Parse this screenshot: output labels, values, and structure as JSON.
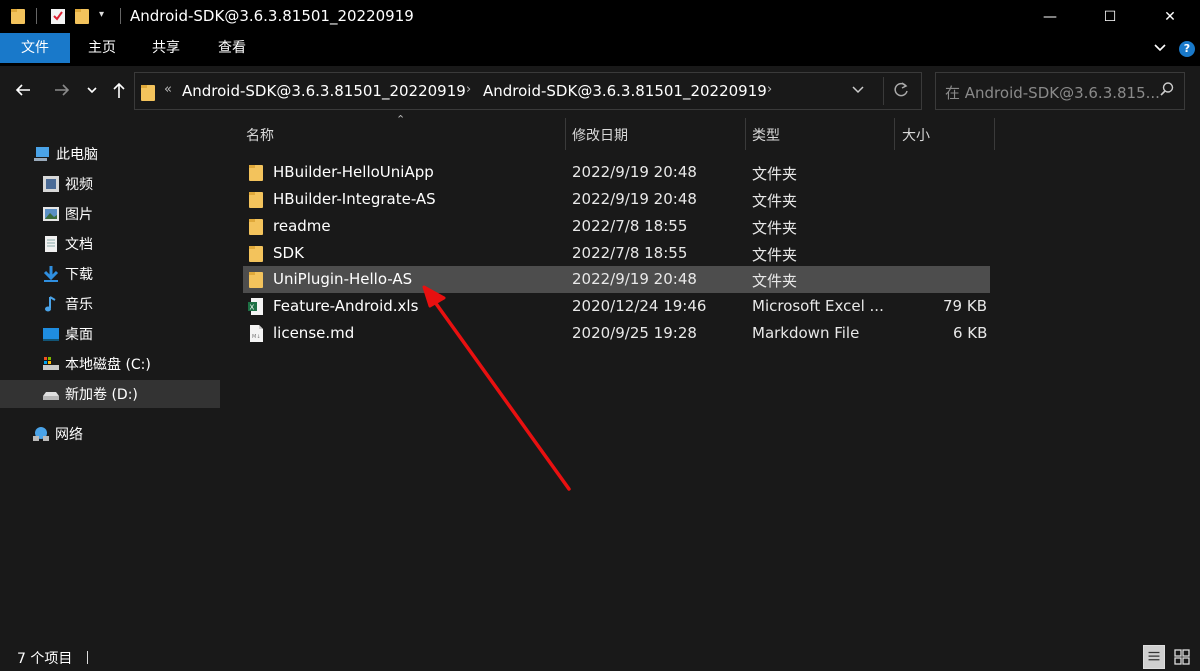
{
  "window": {
    "title": "Android-SDK@3.6.3.81501_20220919",
    "minimize_glyph": "—",
    "maximize_glyph": "☐",
    "close_glyph": "✕"
  },
  "ribbon": {
    "tabs": [
      {
        "label": "文件",
        "active": true
      },
      {
        "label": "主页"
      },
      {
        "label": "共享"
      },
      {
        "label": "查看"
      }
    ],
    "expand_glyph": "⌄",
    "help_glyph": "?"
  },
  "address": {
    "overflow": "«",
    "segments": [
      "Android-SDK@3.6.3.81501_20220919",
      "Android-SDK@3.6.3.81501_20220919"
    ],
    "separator": "›"
  },
  "search": {
    "placeholder": "在 Android-SDK@3.6.3.815..."
  },
  "sidebar": {
    "items": [
      {
        "label": "此电脑",
        "icon": "computer-icon"
      },
      {
        "label": "视频",
        "icon": "video-icon"
      },
      {
        "label": "图片",
        "icon": "pictures-icon"
      },
      {
        "label": "文档",
        "icon": "documents-icon"
      },
      {
        "label": "下载",
        "icon": "download-icon"
      },
      {
        "label": "音乐",
        "icon": "music-icon"
      },
      {
        "label": "桌面",
        "icon": "desktop-icon"
      },
      {
        "label": "本地磁盘 (C:)",
        "icon": "drive-c-icon"
      },
      {
        "label": "新加卷 (D:)",
        "icon": "drive-d-icon",
        "selected": true
      },
      {
        "label": "网络",
        "icon": "network-icon"
      }
    ]
  },
  "columns": {
    "name": "名称",
    "date": "修改日期",
    "type": "类型",
    "size": "大小"
  },
  "files": [
    {
      "name": "HBuilder-HelloUniApp",
      "date": "2022/9/19 20:48",
      "type": "文件夹",
      "size": "",
      "icon": "folder-icon"
    },
    {
      "name": "HBuilder-Integrate-AS",
      "date": "2022/9/19 20:48",
      "type": "文件夹",
      "size": "",
      "icon": "folder-icon"
    },
    {
      "name": "readme",
      "date": "2022/7/8 18:55",
      "type": "文件夹",
      "size": "",
      "icon": "folder-icon"
    },
    {
      "name": "SDK",
      "date": "2022/7/8 18:55",
      "type": "文件夹",
      "size": "",
      "icon": "folder-icon"
    },
    {
      "name": "UniPlugin-Hello-AS",
      "date": "2022/9/19 20:48",
      "type": "文件夹",
      "size": "",
      "icon": "folder-icon",
      "hover": true
    },
    {
      "name": "Feature-Android.xls",
      "date": "2020/12/24 19:46",
      "type": "Microsoft Excel ...",
      "size": "79 KB",
      "icon": "excel-file-icon"
    },
    {
      "name": "license.md",
      "date": "2020/9/25 19:28",
      "type": "Markdown File",
      "size": "6 KB",
      "icon": "markdown-file-icon"
    }
  ],
  "status": {
    "item_count": "7 个项目"
  },
  "colors": {
    "accent": "#1979ca",
    "background": "#191919",
    "titlebar": "#000000",
    "annotation_arrow": "#e81010"
  }
}
